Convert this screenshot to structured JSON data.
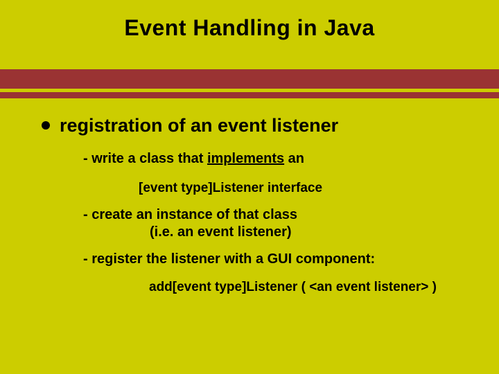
{
  "title": "Event Handling in Java",
  "bullet1": "registration of an event listener",
  "sub1_pre": "- write a class that ",
  "sub1_u": "implements",
  "sub1_post": " an",
  "code1": "[event type]Listener interface",
  "sub2a": "- create an instance of that class",
  "sub2b": "(i.e. an event listener)",
  "sub3": "- register the listener with a GUI component:",
  "code2": "add[event type]Listener ( <an event listener> )"
}
